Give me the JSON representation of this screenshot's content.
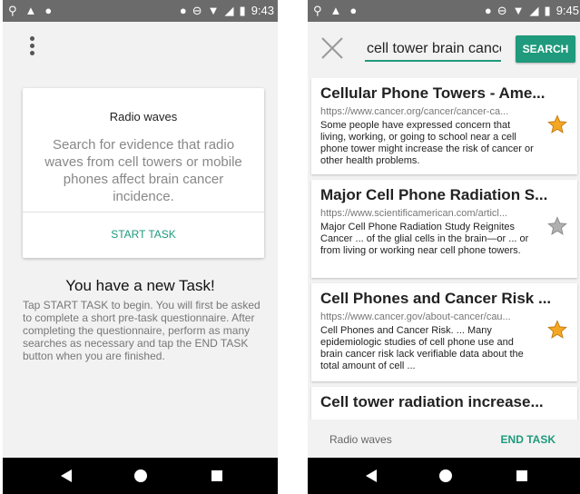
{
  "left_screen": {
    "status_bar": {
      "time": "9:43"
    },
    "task_card": {
      "title": "Radio waves",
      "description": "Search for evidence that radio waves from cell towers or mobile phones affect brain cancer incidence.",
      "start_label": "START TASK"
    },
    "new_task_heading": "You have a new Task!",
    "new_task_body": "Tap START TASK to begin. You will first be asked to complete a short pre-task questionnaire. After completing the questionnaire, perform as many searches as necessary and tap the END TASK button when you are finished."
  },
  "right_screen": {
    "status_bar": {
      "time": "9:45"
    },
    "search": {
      "query": "cell tower brain cancer",
      "button_label": "SEARCH"
    },
    "results": [
      {
        "title": "Cellular Phone Towers - Ame...",
        "url": "https://www.cancer.org/cancer/cancer-ca...",
        "snippet": "Some people have expressed concern that living, working, or going to school near a cell phone tower might increase the risk of cancer or other health problems.",
        "starred": true
      },
      {
        "title": "Major Cell Phone Radiation S...",
        "url": "https://www.scientificamerican.com/articl...",
        "snippet": "Major Cell Phone Radiation Study Reignites Cancer ... of the glial cells in the brain—or ... or from living or working near cell phone towers.",
        "starred": false
      },
      {
        "title": "Cell Phones and Cancer Risk ...",
        "url": "https://www.cancer.gov/about-cancer/cau...",
        "snippet": "Cell Phones and Cancer Risk. ... Many epidemiologic studies of cell phone use and brain cancer risk lack verifiable data about the total amount of cell ...",
        "starred": true
      },
      {
        "title": "Cell tower radiation increase...",
        "url": "",
        "snippet": "",
        "starred": false
      }
    ],
    "bottom_bar": {
      "task_name": "Radio waves",
      "end_label": "END TASK"
    }
  },
  "colors": {
    "accent": "#1f9a7c",
    "status_bar": "#6b6b6b",
    "star_active": "#f5a623",
    "star_inactive": "#b0b0b0"
  }
}
